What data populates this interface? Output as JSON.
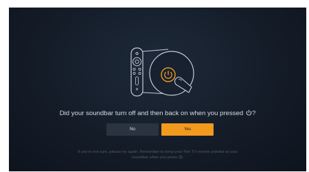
{
  "dialog": {
    "question": "Did your soundbar turn off and then back on when you pressed",
    "question_suffix": "?",
    "power_icon": "power-icon",
    "buttons": {
      "no_label": "No",
      "yes_label": "Yes",
      "selected": "Yes"
    },
    "hint_line1": "If you're not sure, please try again. Remember to keep your Fire TV remote pointed at your",
    "hint_line2": "soundbar when you press",
    "hint_suffix": "."
  },
  "illustration": {
    "remote_icon": "fire-tv-remote-icon",
    "power_button_icon": "power-icon",
    "finger_icon": "finger-press-icon"
  },
  "colors": {
    "accent": "#f29a1e",
    "background": "#141c28",
    "text": "#d8dde3",
    "hint_text": "#4f5b69",
    "no_button": "#2a3441"
  }
}
